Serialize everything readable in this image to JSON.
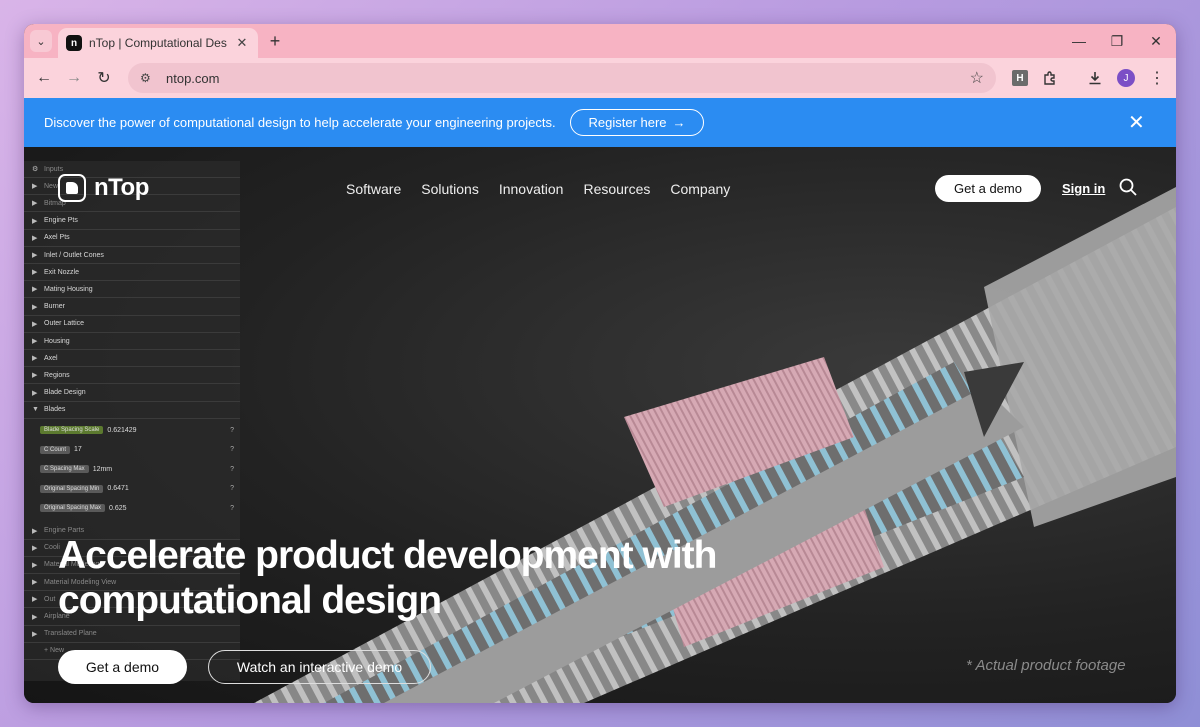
{
  "browser": {
    "tab_title": "nTop | Computational Design Sc",
    "url": "ntop.com",
    "profile_initial": "J",
    "extension_label": "H"
  },
  "banner": {
    "text": "Discover the power of computational design to help accelerate your engineering projects.",
    "button_label": "Register here",
    "accent": "#2b8cf2"
  },
  "nav": {
    "logo_text": "nTop",
    "items": [
      "Software",
      "Solutions",
      "Innovation",
      "Resources",
      "Company"
    ],
    "demo_label": "Get a demo",
    "signin_label": "Sign in"
  },
  "panel": {
    "top_items": [
      "Inputs",
      "New",
      "Bitmap",
      "Engine Pts",
      "Axel Pts",
      "Inlet / Outlet Cones",
      "Exit Nozzle",
      "Mating Housing",
      "Burner",
      "Outer Lattice",
      "Housing",
      "Axel",
      "Regions",
      "Blade Design",
      "Blades"
    ],
    "params": [
      {
        "label": "Blade Spacing Scale",
        "value": "0.621429"
      },
      {
        "label": "C Count",
        "value": "17"
      },
      {
        "label": "C Spacing Max",
        "value": "12mm"
      },
      {
        "label": "Original Spacing Min",
        "value": "0.6471"
      },
      {
        "label": "Original Spacing Max",
        "value": "0.625"
      }
    ],
    "bottom_items": [
      "Engine Parts",
      "Cooli",
      "Material Modeling",
      "Material Modeling View",
      "Out",
      "Airplane",
      "Translated Plane",
      "+ New"
    ]
  },
  "hero": {
    "headline_line1": "Accelerate product development with",
    "headline_line2": "computational design",
    "cta_primary": "Get a demo",
    "cta_secondary": "Watch an interactive demo",
    "footnote": "* Actual product footage"
  }
}
